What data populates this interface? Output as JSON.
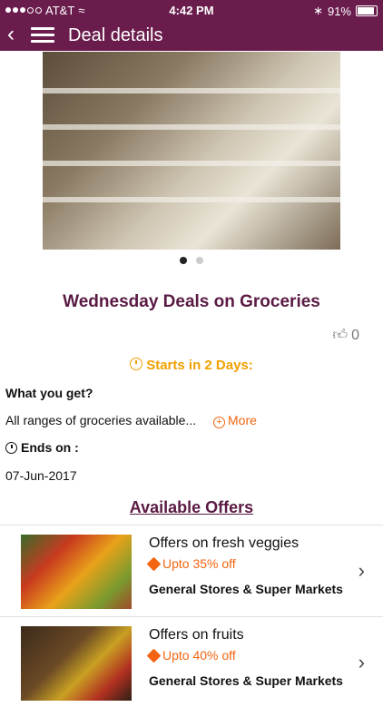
{
  "status_bar": {
    "carrier": "AT&T",
    "time": "4:42 PM",
    "battery": "91%"
  },
  "nav": {
    "title": "Deal details"
  },
  "deal": {
    "title": "Wednesday Deals on Groceries",
    "likes": "0",
    "starts": "Starts in 2 Days:",
    "what_label": "What you get?",
    "description": "All ranges of groceries available...",
    "more_label": "More",
    "ends_label": "Ends on :",
    "end_date": "07-Jun-2017"
  },
  "offers": {
    "heading": "Available Offers",
    "items": [
      {
        "name": "Offers on fresh veggies",
        "discount": "Upto 35% off",
        "category": "General Stores & Super Markets"
      },
      {
        "name": "Offers on fruits",
        "discount": "Upto 40% off",
        "category": "General Stores & Super Markets"
      }
    ]
  },
  "colors": {
    "brand": "#6a1d4d",
    "accent": "#f2640f",
    "starts": "#f0a000"
  }
}
